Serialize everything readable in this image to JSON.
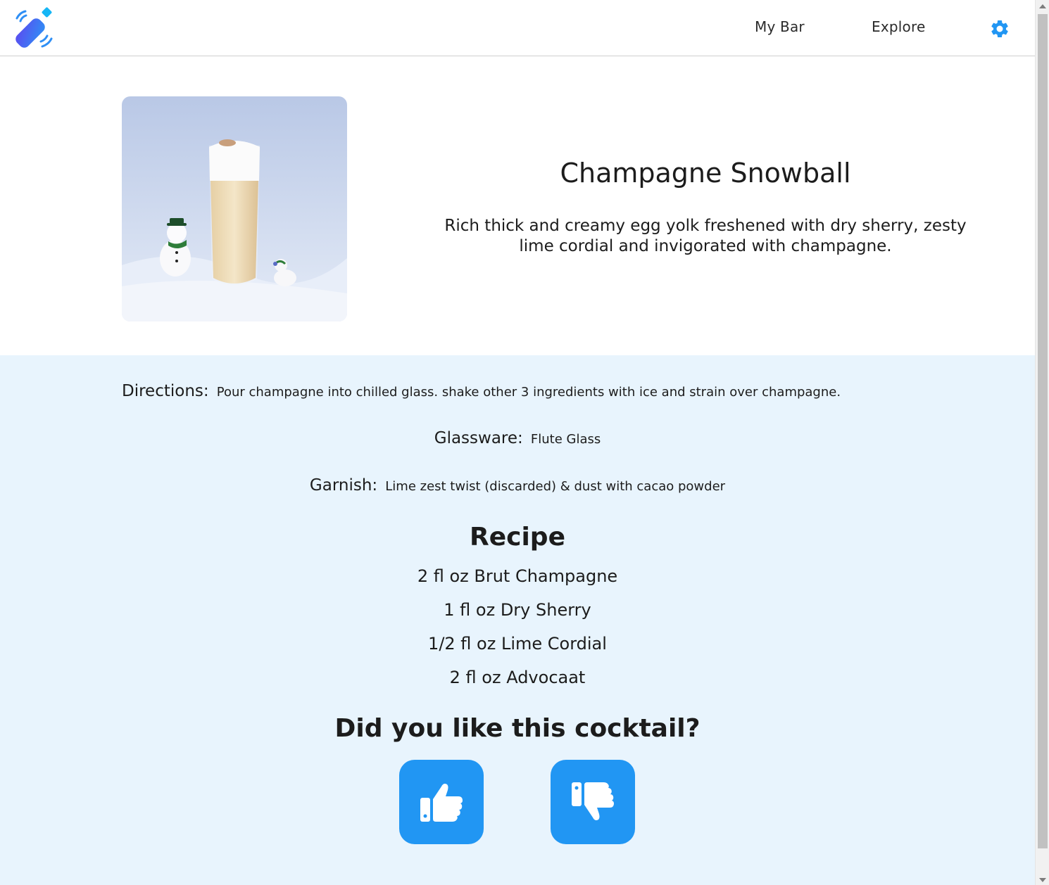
{
  "header": {
    "logo_icon": "cocktail-shaker-logo-icon",
    "nav": {
      "my_bar": "My Bar",
      "explore": "Explore"
    },
    "settings_icon": "gear-icon",
    "accent_color": "#2196f3"
  },
  "cocktail": {
    "name": "Champagne Snowball",
    "description": "Rich thick and creamy egg yolk freshened with dry sherry, zesty lime cordial and invigorated with champagne."
  },
  "details": {
    "directions_label": "Directions:",
    "directions": "Pour champagne into chilled glass. shake other 3 ingredients with ice and strain over champagne.",
    "glassware_label": "Glassware:",
    "glassware": "Flute Glass",
    "garnish_label": "Garnish:",
    "garnish": "Lime zest twist (discarded) & dust with cacao powder"
  },
  "recipe": {
    "title": "Recipe",
    "ingredients": [
      "2 fl oz Brut Champagne",
      "1 fl oz Dry Sherry",
      "1/2 fl oz Lime Cordial",
      "2 fl oz Advocaat"
    ]
  },
  "feedback": {
    "question": "Did you like this cocktail?",
    "like_icon": "thumbs-up-icon",
    "dislike_icon": "thumbs-down-icon"
  },
  "colors": {
    "details_background": "#e8f4fd",
    "button": "#2196f3"
  }
}
